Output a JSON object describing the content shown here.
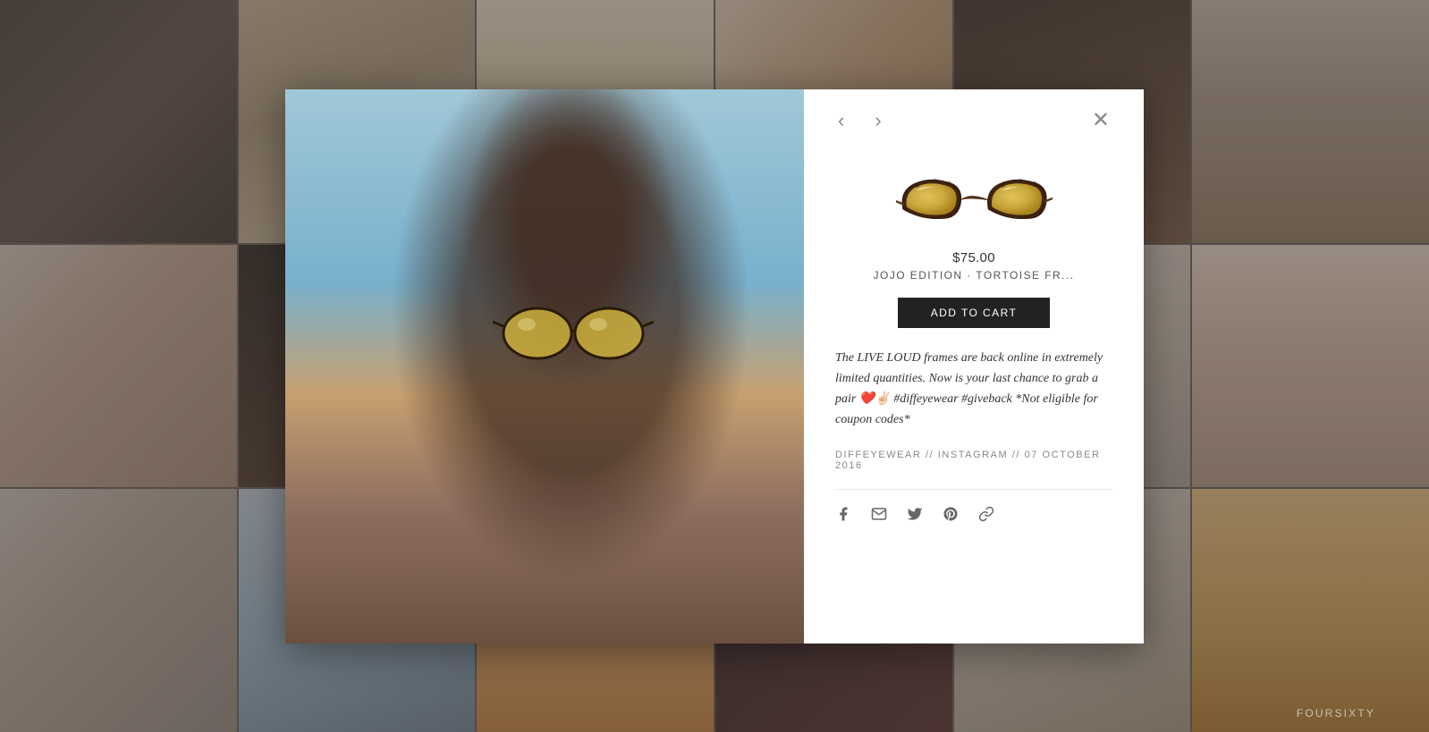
{
  "background": {
    "photos": [
      {
        "id": 1,
        "class": "bg-photo-1"
      },
      {
        "id": 2,
        "class": "bg-photo-2"
      },
      {
        "id": 3,
        "class": "bg-photo-3"
      },
      {
        "id": 4,
        "class": "bg-photo-4"
      },
      {
        "id": 5,
        "class": "bg-photo-5"
      },
      {
        "id": 6,
        "class": "bg-photo-6"
      },
      {
        "id": 7,
        "class": "bg-photo-7"
      },
      {
        "id": 8,
        "class": "bg-photo-8"
      },
      {
        "id": 9,
        "class": "bg-photo-9"
      },
      {
        "id": 10,
        "class": "bg-photo-10"
      },
      {
        "id": 11,
        "class": "bg-photo-11"
      },
      {
        "id": 12,
        "class": "bg-photo-12"
      },
      {
        "id": 13,
        "class": "bg-photo-13"
      },
      {
        "id": 14,
        "class": "bg-photo-14"
      },
      {
        "id": 15,
        "class": "bg-photo-15"
      },
      {
        "id": 16,
        "class": "bg-photo-16"
      },
      {
        "id": 17,
        "class": "bg-photo-17"
      },
      {
        "id": 18,
        "class": "bg-photo-18"
      }
    ],
    "watermark": "FOURSIXTY"
  },
  "modal": {
    "nav": {
      "prev_label": "‹",
      "next_label": "›",
      "close_label": "✕"
    },
    "product": {
      "price": "$75.00",
      "title": "JOJO EDITION · TORTOISE FR...",
      "add_to_cart_label": "ADD TO CART",
      "description": "The LIVE LOUD frames are back online in extremely limited quantities. Now is your last chance to grab a pair ❤️✌🏻 #diffeyewear #giveback *Not eligible for coupon codes*",
      "meta": "DIFFEYEWEAR // INSTAGRAM // 07 OCTOBER 2016"
    },
    "social": {
      "facebook_label": "f",
      "email_label": "✉",
      "twitter_label": "🐦",
      "pinterest_label": "p",
      "link_label": "⚯"
    }
  }
}
